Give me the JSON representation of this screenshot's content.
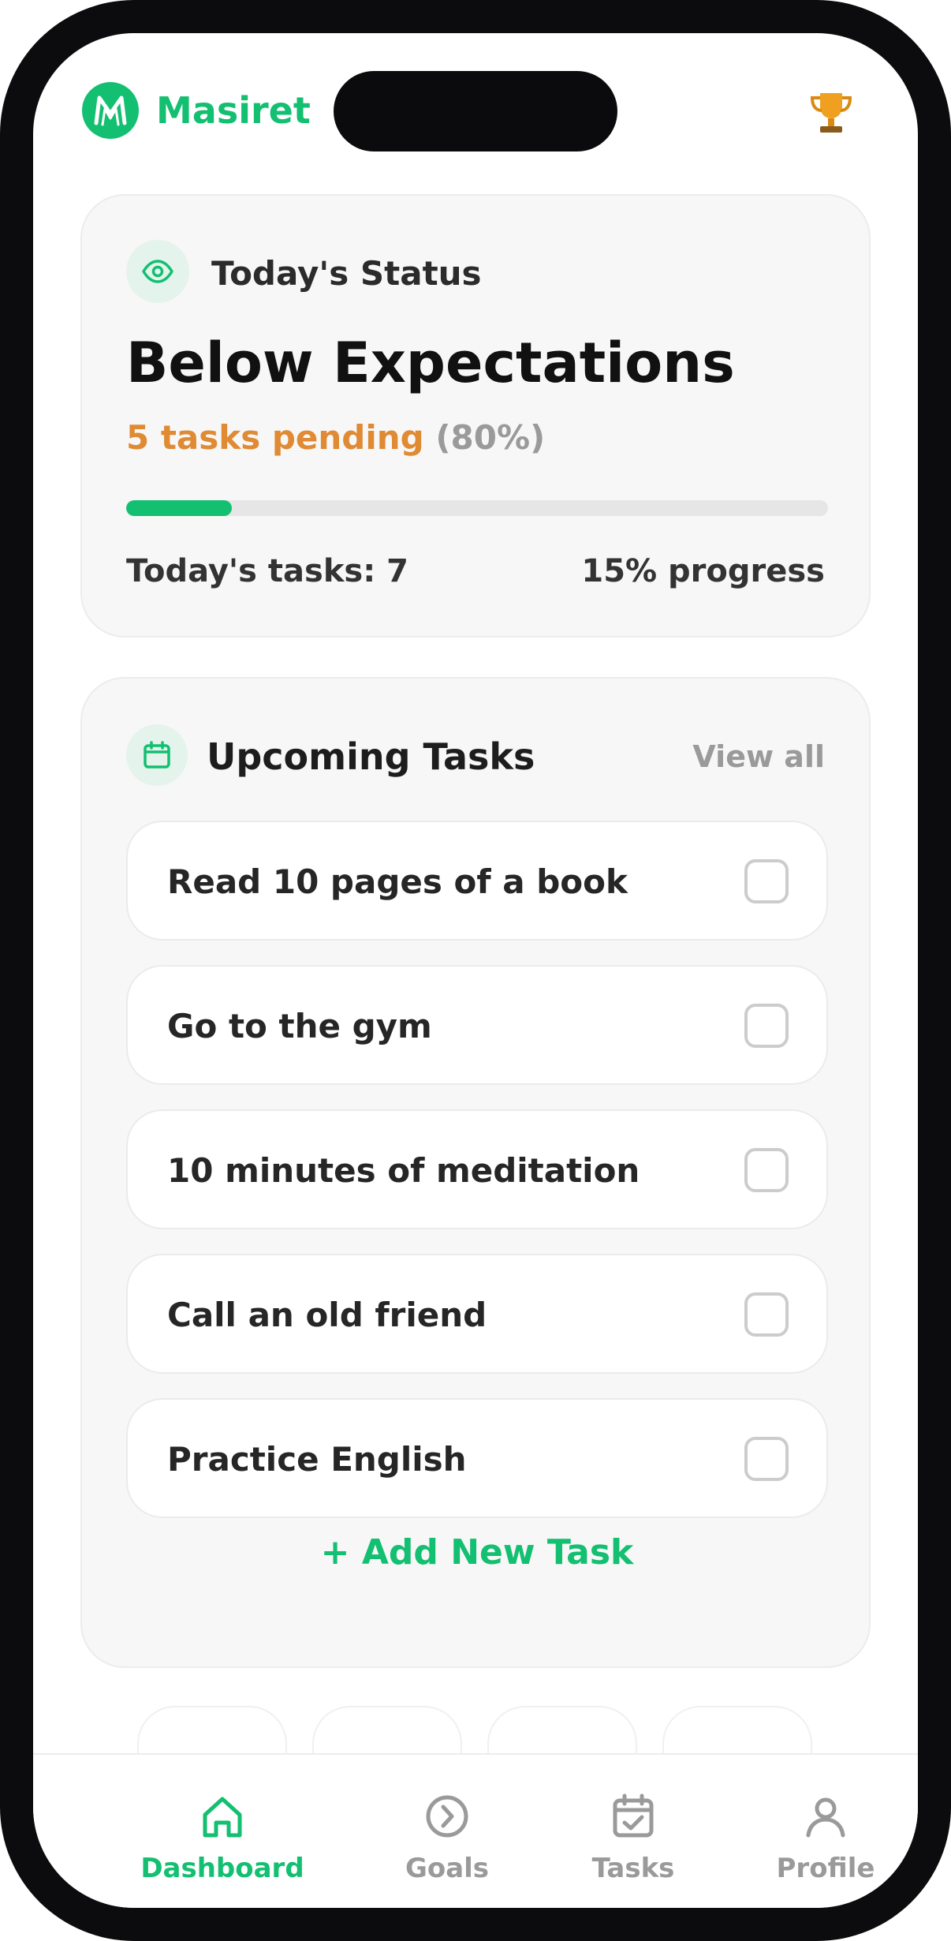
{
  "app": {
    "name": "Masiret"
  },
  "colors": {
    "brand": "#13bf70",
    "warning": "#e08a33",
    "muted": "#9a9a9a",
    "trophy": "#f0a020"
  },
  "header": {
    "trophy_icon": "trophy-icon"
  },
  "status": {
    "label": "Today's Status",
    "title": "Below Expectations",
    "pending_text": "5 tasks pending",
    "pending_pct": "(80%)",
    "progress_fraction": 0.15,
    "tasks_text": "Today's tasks: 7",
    "progress_text": "15% progress"
  },
  "upcoming": {
    "title": "Upcoming Tasks",
    "view_all": "View all",
    "tasks": [
      {
        "label": "Read 10 pages of a book",
        "checked": false
      },
      {
        "label": "Go to the gym",
        "checked": false
      },
      {
        "label": "10 minutes of meditation",
        "checked": false
      },
      {
        "label": "Call an old friend",
        "checked": false
      },
      {
        "label": "Practice English",
        "checked": false
      }
    ],
    "add_label": "+ Add New Task"
  },
  "tabs": [
    {
      "label": "Dashboard",
      "icon": "home-icon",
      "active": true
    },
    {
      "label": "Goals",
      "icon": "compass-icon",
      "active": false
    },
    {
      "label": "Tasks",
      "icon": "calendar-check-icon",
      "active": false
    },
    {
      "label": "Profile",
      "icon": "user-icon",
      "active": false
    }
  ]
}
